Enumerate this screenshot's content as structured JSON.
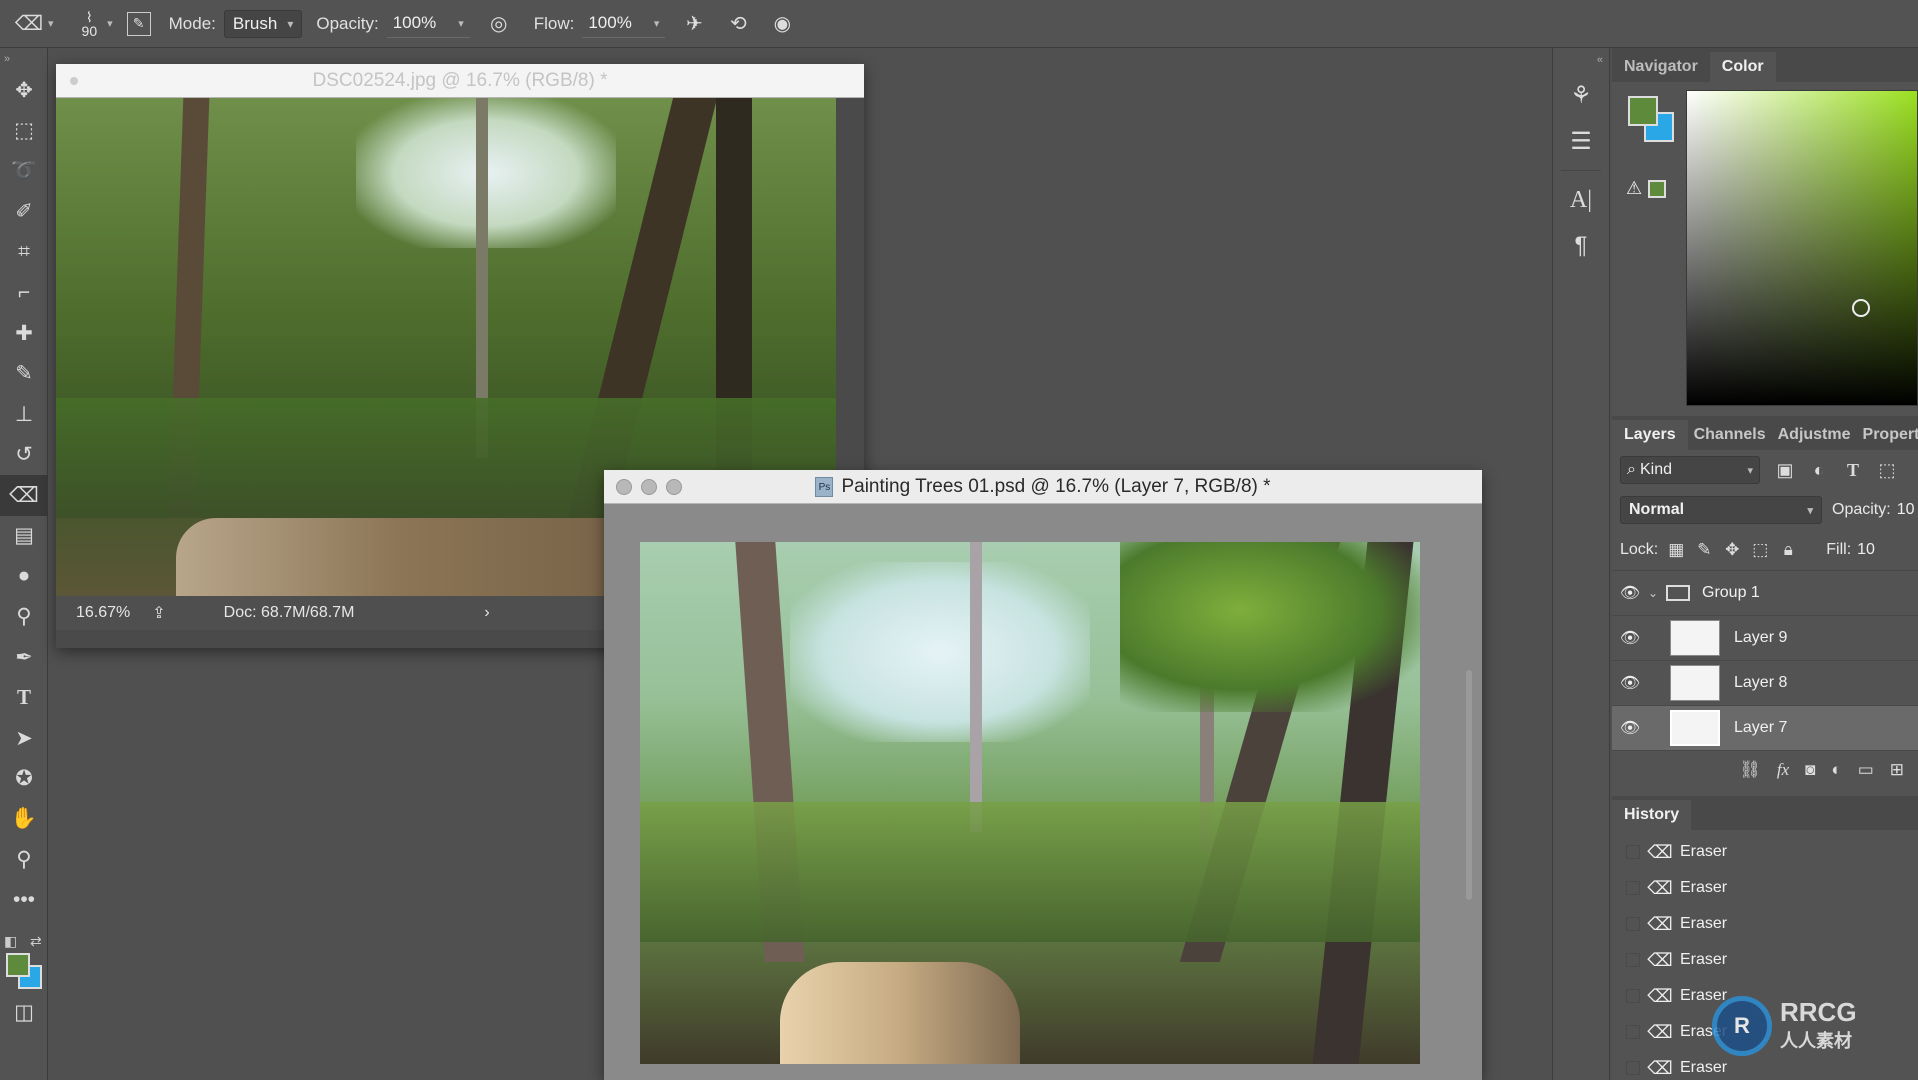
{
  "options_bar": {
    "brush_size": "90",
    "mode_label": "Mode:",
    "mode_value": "Brush",
    "opacity_label": "Opacity:",
    "opacity_value": "100%",
    "flow_label": "Flow:",
    "flow_value": "100%"
  },
  "icons": {
    "eraser": "eraser-icon",
    "airbrush": "airbrush-icon",
    "pressure": "pressure-icon"
  },
  "window1": {
    "title": "DSC02524.jpg @ 16.7% (RGB/8) *",
    "zoom": "16.67%",
    "doc_info": "Doc: 68.7M/68.7M"
  },
  "window2": {
    "title": "Painting Trees 01.psd @ 16.7% (Layer 7, RGB/8) *"
  },
  "panels": {
    "tabs_top": [
      "Navigator",
      "Color"
    ],
    "tabs_layers": [
      "Layers",
      "Channels",
      "Adjustme",
      "Propert"
    ],
    "kind_label": "Kind",
    "blend_mode": "Normal",
    "opacity_label": "Opacity:",
    "opacity_value": "10",
    "lock_label": "Lock:",
    "fill_label": "Fill:",
    "fill_value": "10",
    "history_title": "History"
  },
  "colors": {
    "foreground": "#5e8a3c",
    "background": "#2aa7e6"
  },
  "layers": [
    {
      "name": "Group 1"
    },
    {
      "name": "Layer 9"
    },
    {
      "name": "Layer 8"
    },
    {
      "name": "Layer 7"
    }
  ],
  "history": [
    "Eraser",
    "Eraser",
    "Eraser",
    "Eraser",
    "Eraser",
    "Eraser",
    "Eraser"
  ],
  "watermark": "RRCG 人人素材"
}
